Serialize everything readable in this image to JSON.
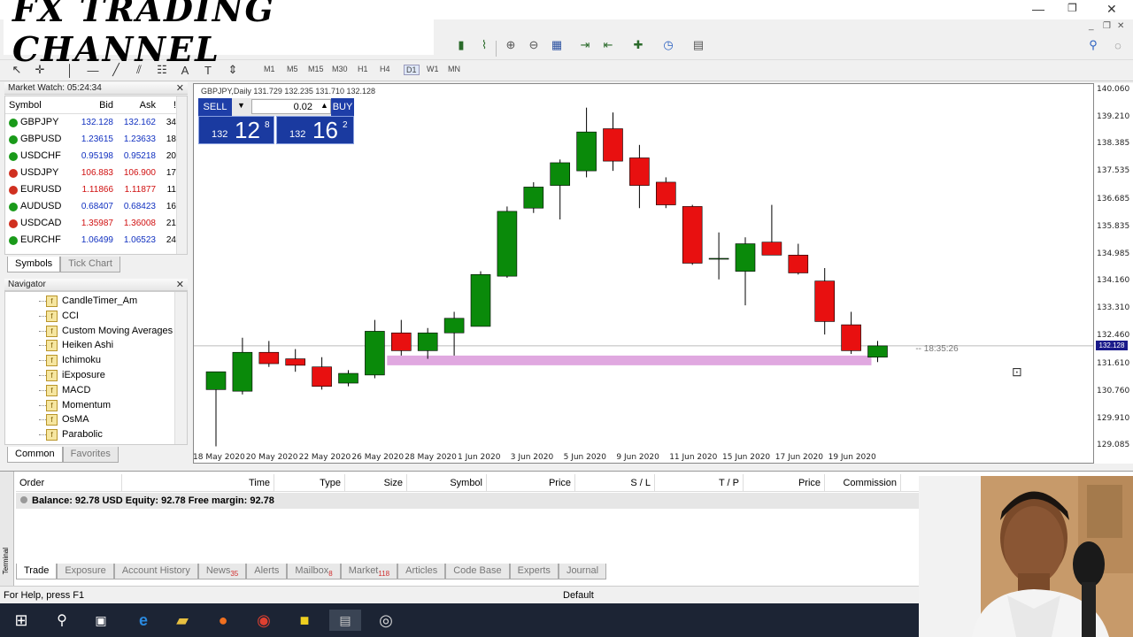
{
  "banner": {
    "text": "FX TRADING CHANNEL"
  },
  "toolbar": {
    "timeframes": [
      "M1",
      "M5",
      "M15",
      "M30",
      "H1",
      "H4",
      "D1",
      "W1",
      "MN"
    ]
  },
  "market_watch": {
    "title": "Market Watch: 05:24:34",
    "columns": {
      "symbol": "Symbol",
      "bid": "Bid",
      "ask": "Ask",
      "spread": "!"
    },
    "rows": [
      {
        "symbol": "GBPJPY",
        "bid": "132.128",
        "ask": "132.162",
        "spread": "34",
        "dir": "up"
      },
      {
        "symbol": "GBPUSD",
        "bid": "1.23615",
        "ask": "1.23633",
        "spread": "18",
        "dir": "up"
      },
      {
        "symbol": "USDCHF",
        "bid": "0.95198",
        "ask": "0.95218",
        "spread": "20",
        "dir": "up"
      },
      {
        "symbol": "USDJPY",
        "bid": "106.883",
        "ask": "106.900",
        "spread": "17",
        "dir": "down"
      },
      {
        "symbol": "EURUSD",
        "bid": "1.11866",
        "ask": "1.11877",
        "spread": "11",
        "dir": "down"
      },
      {
        "symbol": "AUDUSD",
        "bid": "0.68407",
        "ask": "0.68423",
        "spread": "16",
        "dir": "up"
      },
      {
        "symbol": "USDCAD",
        "bid": "1.35987",
        "ask": "1.36008",
        "spread": "21",
        "dir": "down"
      },
      {
        "symbol": "EURCHF",
        "bid": "1.06499",
        "ask": "1.06523",
        "spread": "24",
        "dir": "up"
      }
    ],
    "tabs": [
      "Symbols",
      "Tick Chart"
    ]
  },
  "navigator": {
    "title": "Navigator",
    "items": [
      "CandleTimer_Am",
      "CCI",
      "Custom Moving Averages",
      "Heiken Ashi",
      "Ichimoku",
      "iExposure",
      "MACD",
      "Momentum",
      "OsMA",
      "Parabolic"
    ],
    "tabs": [
      "Common",
      "Favorites"
    ]
  },
  "chart": {
    "header": "GBPJPY,Daily  131.729 132.235 131.710 132.128",
    "timer": "-- 18:35:26",
    "price_tag": "132.128",
    "sell_label": "SELL",
    "buy_label": "BUY",
    "lot": "0.02",
    "sell_prefix": "132",
    "sell_big": "12",
    "sell_sup": "8",
    "buy_prefix": "132",
    "buy_big": "16",
    "buy_sup": "2"
  },
  "chart_data": {
    "type": "candlestick",
    "symbol": "GBPJPY",
    "timeframe": "Daily",
    "y_ticks": [
      "140.060",
      "139.210",
      "138.385",
      "137.535",
      "136.685",
      "135.835",
      "134.985",
      "134.160",
      "133.310",
      "132.460",
      "131.610",
      "130.760",
      "129.910",
      "129.085"
    ],
    "x_ticks": [
      "18 May 2020",
      "20 May 2020",
      "22 May 2020",
      "26 May 2020",
      "28 May 2020",
      "1 Jun 2020",
      "3 Jun 2020",
      "5 Jun 2020",
      "9 Jun 2020",
      "11 Jun 2020",
      "15 Jun 2020",
      "17 Jun 2020",
      "19 Jun 2020"
    ],
    "ylim": [
      129.085,
      140.06
    ],
    "candles": [
      {
        "o": 130.85,
        "h": 131.4,
        "l": 129.1,
        "c": 131.4
      },
      {
        "o": 130.8,
        "h": 132.45,
        "l": 130.7,
        "c": 132.0
      },
      {
        "o": 132.0,
        "h": 132.35,
        "l": 131.55,
        "c": 131.65
      },
      {
        "o": 131.8,
        "h": 132.1,
        "l": 131.4,
        "c": 131.6
      },
      {
        "o": 131.55,
        "h": 131.85,
        "l": 130.85,
        "c": 130.95
      },
      {
        "o": 131.05,
        "h": 131.45,
        "l": 130.95,
        "c": 131.35
      },
      {
        "o": 131.3,
        "h": 133.0,
        "l": 131.2,
        "c": 132.65
      },
      {
        "o": 132.6,
        "h": 133.0,
        "l": 131.9,
        "c": 132.05
      },
      {
        "o": 132.05,
        "h": 132.75,
        "l": 131.8,
        "c": 132.6
      },
      {
        "o": 132.6,
        "h": 133.25,
        "l": 131.9,
        "c": 133.05
      },
      {
        "o": 132.8,
        "h": 134.5,
        "l": 132.8,
        "c": 134.4
      },
      {
        "o": 134.35,
        "h": 136.5,
        "l": 134.3,
        "c": 136.35
      },
      {
        "o": 136.45,
        "h": 137.25,
        "l": 136.3,
        "c": 137.1
      },
      {
        "o": 137.15,
        "h": 137.95,
        "l": 136.1,
        "c": 137.85
      },
      {
        "o": 137.6,
        "h": 139.55,
        "l": 137.4,
        "c": 138.8
      },
      {
        "o": 138.9,
        "h": 139.4,
        "l": 137.6,
        "c": 137.9
      },
      {
        "o": 138.0,
        "h": 138.4,
        "l": 136.45,
        "c": 137.15
      },
      {
        "o": 137.25,
        "h": 137.4,
        "l": 136.45,
        "c": 136.55
      },
      {
        "o": 136.5,
        "h": 136.55,
        "l": 134.7,
        "c": 134.75
      },
      {
        "o": 134.9,
        "h": 135.7,
        "l": 134.25,
        "c": 134.9
      },
      {
        "o": 134.5,
        "h": 135.55,
        "l": 133.45,
        "c": 135.35
      },
      {
        "o": 135.4,
        "h": 136.55,
        "l": 135.05,
        "c": 135.0
      },
      {
        "o": 135.0,
        "h": 135.35,
        "l": 134.4,
        "c": 134.45
      },
      {
        "o": 134.2,
        "h": 134.6,
        "l": 132.55,
        "c": 132.95
      },
      {
        "o": 132.85,
        "h": 133.25,
        "l": 131.95,
        "c": 132.05
      },
      {
        "o": 131.85,
        "h": 132.35,
        "l": 131.7,
        "c": 132.2
      }
    ],
    "zone": {
      "from": 131.6,
      "to": 131.9,
      "color": "#e0a8e0"
    }
  },
  "terminal": {
    "side_label": "Terminal",
    "columns": [
      "Order",
      "Time",
      "Type",
      "Size",
      "Symbol",
      "Price",
      "S / L",
      "T / P",
      "Price",
      "Commission"
    ],
    "balance": "Balance: 92.78 USD  Equity: 92.78  Free margin: 92.78",
    "tabs": [
      {
        "label": "Trade",
        "badge": ""
      },
      {
        "label": "Exposure",
        "badge": ""
      },
      {
        "label": "Account History",
        "badge": ""
      },
      {
        "label": "News",
        "badge": "35"
      },
      {
        "label": "Alerts",
        "badge": ""
      },
      {
        "label": "Mailbox",
        "badge": "8"
      },
      {
        "label": "Market",
        "badge": "118"
      },
      {
        "label": "Articles",
        "badge": ""
      },
      {
        "label": "Code Base",
        "badge": ""
      },
      {
        "label": "Experts",
        "badge": ""
      },
      {
        "label": "Journal",
        "badge": ""
      }
    ]
  },
  "status": {
    "help": "For Help, press F1",
    "profile": "Default"
  },
  "colors": {
    "bull": "#0a8a0a",
    "bear": "#e81010",
    "zone": "#e0a8e0",
    "oct_blue": "#1e3ea8"
  }
}
